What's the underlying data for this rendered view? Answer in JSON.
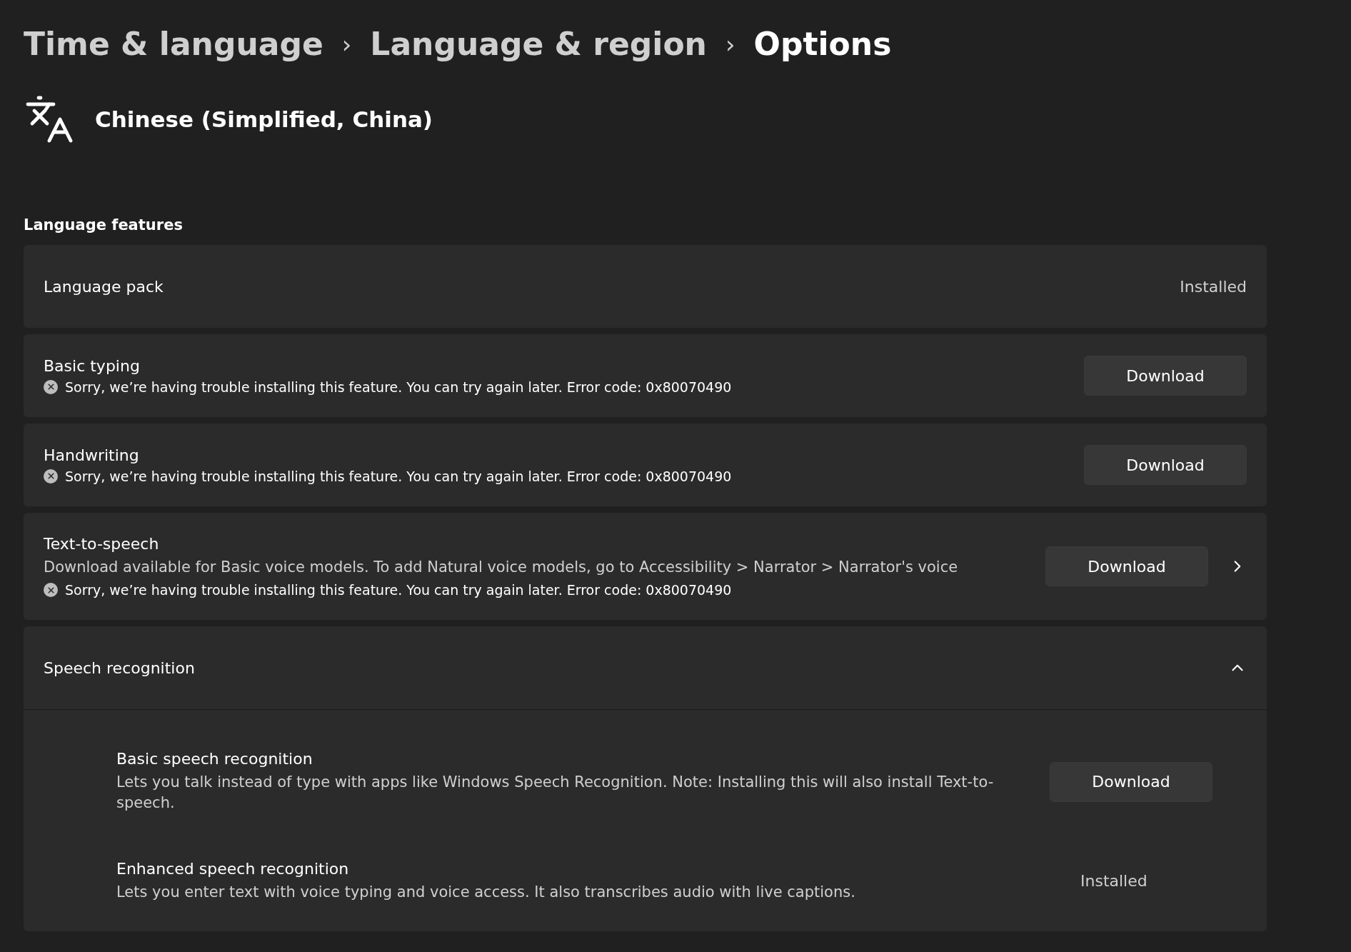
{
  "breadcrumb": [
    {
      "label": "Time & language",
      "current": false
    },
    {
      "label": "Language & region",
      "current": false
    },
    {
      "label": "Options",
      "current": true
    }
  ],
  "breadcrumb_separator": "›",
  "language": {
    "name": "Chinese (Simplified, China)"
  },
  "section_title": "Language features",
  "features": [
    {
      "title": "Language pack",
      "kind": "status",
      "status": "Installed"
    },
    {
      "title": "Basic typing",
      "kind": "download",
      "button": "Download",
      "error": "Sorry, we’re having trouble installing this feature. You can try again later. Error code: 0x80070490"
    },
    {
      "title": "Handwriting",
      "kind": "download",
      "button": "Download",
      "error": "Sorry, we’re having trouble installing this feature. You can try again later. Error code: 0x80070490"
    },
    {
      "title": "Text-to-speech",
      "kind": "download",
      "button": "Download",
      "description": "Download available for Basic voice models. To add Natural voice models, go to Accessibility > Narrator > Narrator's voice",
      "error": "Sorry, we’re having trouble installing this feature. You can try again later. Error code: 0x80070490",
      "has_chevron": true
    },
    {
      "title": "Speech recognition",
      "kind": "group",
      "expanded": true,
      "children": [
        {
          "title": "Basic speech recognition",
          "kind": "download",
          "button": "Download",
          "description": "Lets you talk instead of type with apps like Windows Speech Recognition. Note: Installing this will also install Text-to-speech."
        },
        {
          "title": "Enhanced speech recognition",
          "kind": "status",
          "status": "Installed",
          "description": "Lets you enter text with voice typing and voice access. It also transcribes audio with live captions."
        }
      ]
    }
  ]
}
